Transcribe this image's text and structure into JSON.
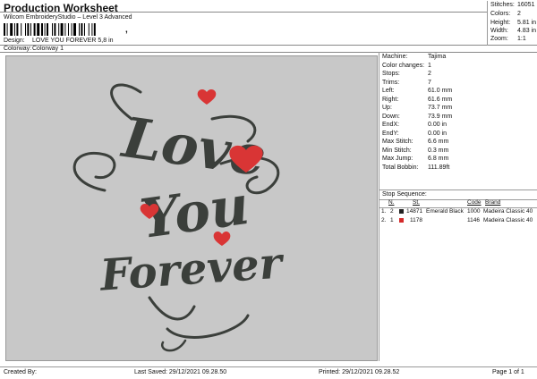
{
  "header": {
    "title": "Production Worksheet",
    "software": "Wilcom EmbroideryStudio – Level 3 Advanced",
    "barcode_suffix": ",",
    "design_label": "Design:",
    "design_value": "LOVE YOU FOREVER 5,8 in",
    "colorway_label": "Colorway:",
    "colorway_value": "Colorway 1"
  },
  "stats": [
    {
      "label": "Stitches:",
      "value": "16051"
    },
    {
      "label": "Colors:",
      "value": "2"
    },
    {
      "label": "Height:",
      "value": "5.81 in"
    },
    {
      "label": "Width:",
      "value": "4.83 in"
    },
    {
      "label": "Zoom:",
      "value": "1:1"
    }
  ],
  "machine_info": [
    {
      "label": "Machine:",
      "value": "Tajima"
    },
    {
      "label": "Color changes:",
      "value": "1"
    },
    {
      "label": "Stops:",
      "value": "2"
    },
    {
      "label": "Trims:",
      "value": "7"
    },
    {
      "label": "Left:",
      "value": "61.0 mm"
    },
    {
      "label": "Right:",
      "value": "61.6 mm"
    },
    {
      "label": "Up:",
      "value": "73.7 mm"
    },
    {
      "label": "Down:",
      "value": "73.9 mm"
    },
    {
      "label": "EndX:",
      "value": "0.00 in"
    },
    {
      "label": "EndY:",
      "value": "0.00 in"
    },
    {
      "label": "Max Stitch:",
      "value": "6.6 mm"
    },
    {
      "label": "Min Stitch:",
      "value": "0.3 mm"
    },
    {
      "label": "Max Jump:",
      "value": "6.8 mm"
    },
    {
      "label": "Total Bobbin:",
      "value": "111.89ft"
    }
  ],
  "stop_sequence": {
    "label": "Stop Sequence:",
    "headers": {
      "n": "N.",
      "st": "St.",
      "code": "Code",
      "brand": "Brand"
    },
    "rows": [
      {
        "idx": "1.",
        "n": "2",
        "color": "#222222",
        "st": "14871",
        "name": "Emerald Black",
        "code": "1000",
        "brand": "Madeira Classic 40"
      },
      {
        "idx": "2.",
        "n": "1",
        "color": "#d42a2a",
        "st": "1178",
        "name": "",
        "code": "1146",
        "brand": "Madeira Classic 40"
      }
    ]
  },
  "artwork": {
    "words": [
      "Love",
      "You",
      "Forever"
    ],
    "thread_color": "#3b3f3b",
    "heart_color": "#d93535",
    "background": "#c8c8c8"
  },
  "footer": {
    "created_by": "Created By:",
    "last_saved": "Last Saved: 29/12/2021 09.28.50",
    "printed": "Printed: 29/12/2021 09.28.52",
    "page": "Page 1 of 1"
  }
}
